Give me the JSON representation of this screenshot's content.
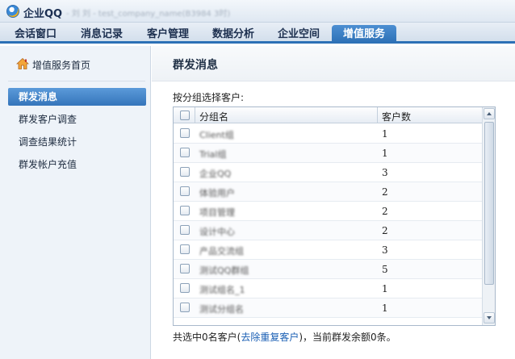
{
  "window": {
    "app_title": "企业QQ",
    "subtitle": "- 刘 刘 - test_company_name(B3984 3时)"
  },
  "tabs": [
    {
      "label": "会话窗口"
    },
    {
      "label": "消息记录"
    },
    {
      "label": "客户管理"
    },
    {
      "label": "数据分析"
    },
    {
      "label": "企业空间"
    },
    {
      "label": "增值服务",
      "active": true
    }
  ],
  "sidebar": {
    "home_label": "增值服务首页",
    "items": [
      {
        "label": "群发消息",
        "active": true
      },
      {
        "label": "群发客户调查"
      },
      {
        "label": "调查结果统计"
      },
      {
        "label": "群发帐户充值"
      }
    ]
  },
  "main": {
    "title": "群发消息",
    "group_select_label": "按分组选择客户:",
    "table": {
      "headers": [
        "分组名",
        "客户数"
      ],
      "rows": [
        {
          "name": "Client组",
          "count": "1"
        },
        {
          "name": "Trial组",
          "count": "1"
        },
        {
          "name": "企业QQ",
          "count": "3"
        },
        {
          "name": "体验用户",
          "count": "2"
        },
        {
          "name": "项目管理",
          "count": "2"
        },
        {
          "name": "设计中心",
          "count": "2"
        },
        {
          "name": "产品交流组",
          "count": "3"
        },
        {
          "name": "测试QQ群组",
          "count": "5"
        },
        {
          "name": "测试组名_1",
          "count": "1"
        },
        {
          "name": "测试分组名",
          "count": "1"
        }
      ]
    },
    "footer": {
      "prefix": "共选中0名客户(",
      "link": "去除重复客户",
      "suffix": ")，当前群发余额0条。"
    }
  },
  "colors": {
    "accent": "#2b70b6",
    "sidebar_active": "#3a7bc0",
    "link": "#1a5fb4"
  }
}
